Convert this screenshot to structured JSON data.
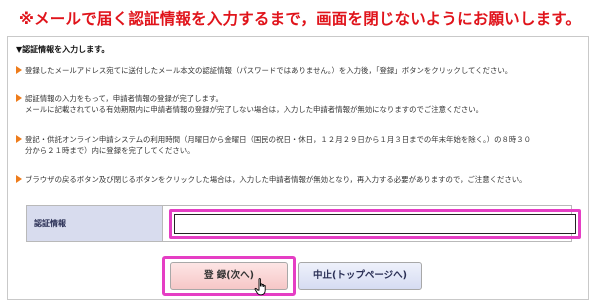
{
  "warning": "※メールで届く認証情報を入力するまで，画面を閉じないようにお願いします。",
  "section_heading": "▼認証情報を入力します。",
  "paragraphs": {
    "p1": "登録したメールアドレス宛てに送付したメール本文の認証情報（パスワードではありません。）を入力後，「登録」ボタンをクリックしてください。",
    "p2_line1": "認証情報の入力をもって，申請者情報の登録が完了します。",
    "p2_line2": "メールに記載されている有効期限内に申請者情報の登録が完了しない場合は，入力した申請者情報が無効になりますのでご注意ください。",
    "p3_line1": "登記・供託オンライン申請システムの利用時間（月曜日から金曜日（国民の祝日・休日，１２月２９日から１月３日までの年末年始を除く。）の８時３０",
    "p3_line2": "分から２１時まで）内に登録を完了してください。",
    "p4": "ブラウザの戻るボタン及び閉じるボタンをクリックした場合は，入力した申請者情報が無効となり，再入力する必要がありますので，ご注意ください。"
  },
  "form": {
    "auth_label": "認証情報",
    "auth_value": ""
  },
  "buttons": {
    "register": "登 録(次へ)",
    "cancel": "中止(トップページへ)"
  },
  "colors": {
    "warning": "#e0141b",
    "arrow": "#ee7c1b",
    "highlight": "#e53ec4",
    "label_bg": "#d8dcee"
  },
  "icons": {
    "bullet": "orange-triangle-arrow-icon",
    "cursor": "hand-pointer-icon"
  }
}
